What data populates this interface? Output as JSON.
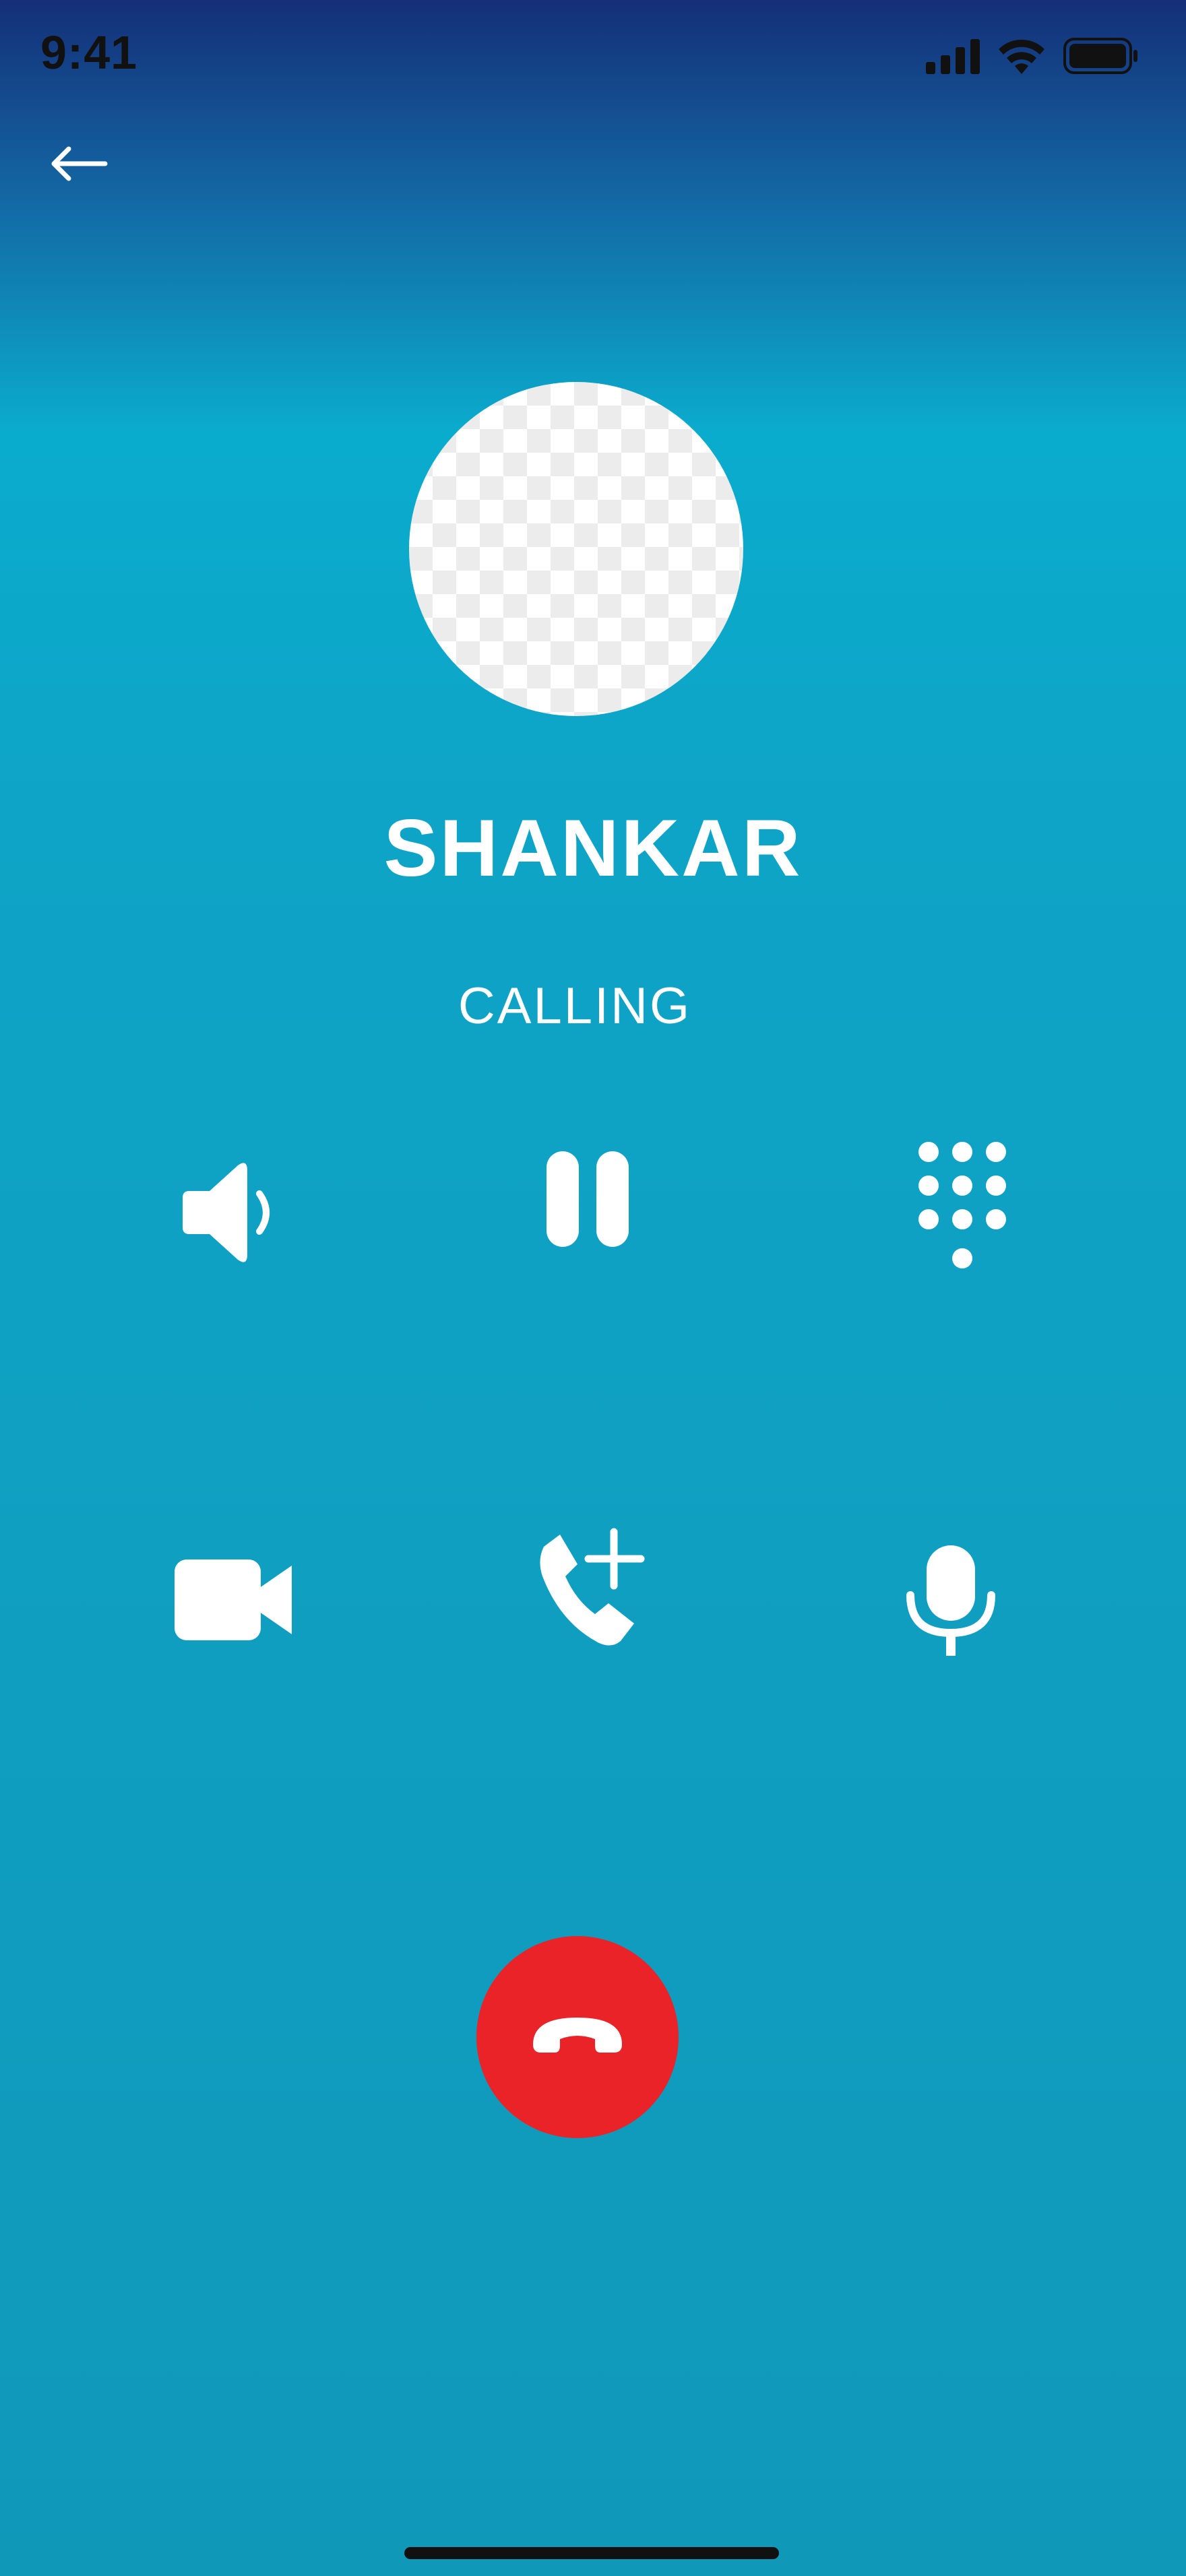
{
  "status_bar": {
    "time": "9:41",
    "icons": [
      "cellular-signal-icon",
      "wifi-icon",
      "battery-icon"
    ]
  },
  "navigation": {
    "back_icon": "arrow-left-icon"
  },
  "contact": {
    "name": "SHANKAR",
    "avatar": "placeholder-checkerboard"
  },
  "call": {
    "status": "CALLING"
  },
  "controls": [
    {
      "icon": "speaker-icon"
    },
    {
      "icon": "pause-icon"
    },
    {
      "icon": "dialpad-icon"
    },
    {
      "icon": "video-camera-icon"
    },
    {
      "icon": "add-call-icon"
    },
    {
      "icon": "microphone-icon"
    }
  ],
  "end_call": {
    "icon": "hang-up-icon",
    "color": "#e92328"
  },
  "colors": {
    "background_top": "#142f78",
    "background_main": "#0ea4c7",
    "foreground": "#ffffff"
  }
}
